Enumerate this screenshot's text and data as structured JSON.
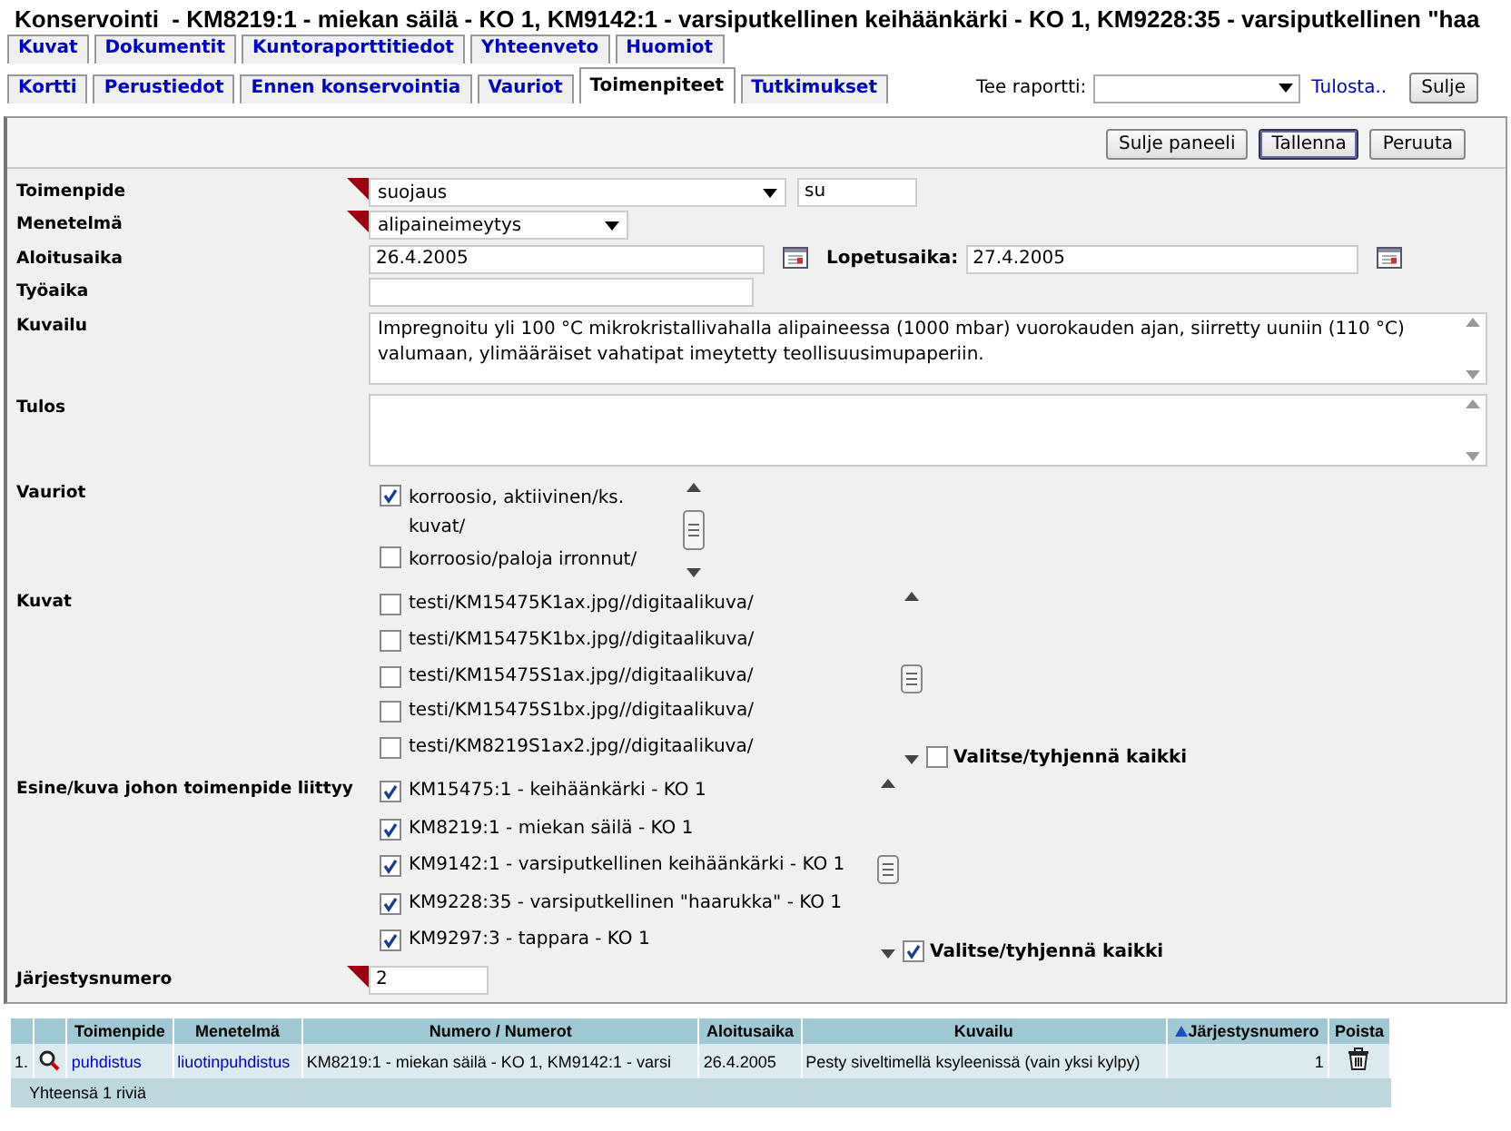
{
  "window": {
    "title": "Konservointi  - KM8219:1 - miekan säilä - KO 1, KM9142:1 - varsiputkellinen keihäänkärki - KO 1, KM9228:35 - varsiputkellinen \"haa"
  },
  "tabs_top": [
    {
      "label": "Kuvat",
      "selected": false
    },
    {
      "label": "Dokumentit",
      "selected": false
    },
    {
      "label": "Kuntoraporttitiedot",
      "selected": false
    },
    {
      "label": "Yhteenveto",
      "selected": false
    },
    {
      "label": "Huomiot",
      "selected": false
    }
  ],
  "tabs": [
    {
      "label": "Kortti",
      "selected": false
    },
    {
      "label": "Perustiedot",
      "selected": false
    },
    {
      "label": "Ennen konservointia",
      "selected": false
    },
    {
      "label": "Vauriot",
      "selected": false
    },
    {
      "label": "Toimenpiteet",
      "selected": true
    },
    {
      "label": "Tutkimukset",
      "selected": false
    }
  ],
  "report": {
    "label": "Tee raportti:",
    "print_link": "Tulosta..",
    "close_button": "Sulje"
  },
  "panel_buttons": [
    {
      "label": "Sulje paneeli",
      "focused": false
    },
    {
      "label": "Tallenna",
      "focused": true
    },
    {
      "label": "Peruuta",
      "focused": false
    }
  ],
  "fields": [
    {
      "kind": "select",
      "label": "Toimenpide",
      "required": true,
      "value": "suojaus",
      "code": "su"
    },
    {
      "kind": "select",
      "label": "Menetelmä",
      "required": true,
      "value": "alipaineimeytys"
    },
    {
      "kind": "date_pair",
      "label": "Aloitusaika",
      "value": "26.4.2005",
      "second_label": "Lopetusaika:",
      "second_value": "27.4.2005"
    },
    {
      "kind": "text",
      "label": "Työaika"
    },
    {
      "kind": "textarea",
      "label": "Kuvailu",
      "value": "Impregnoitu yli 100 °C mikrokristallivahalla alipaineessa (1000 mbar) vuorokauden ajan, siirretty uuniin (110 °C) valumaan, ylimääräiset vahatipat imeytetty teollisuusimupaperiin."
    },
    {
      "kind": "textarea",
      "label": "Tulos"
    },
    {
      "kind": "checklist",
      "label": "Vauriot",
      "items": [
        {
          "label": "korroosio, aktiivinen/ks. kuvat/",
          "checked": true
        },
        {
          "label": "korroosio/paloja irronnut/",
          "checked": false
        }
      ]
    },
    {
      "kind": "checklist",
      "label": "Kuvat",
      "items": [
        {
          "label": "testi/KM15475K1ax.jpg//digitaalikuva/",
          "checked": false
        },
        {
          "label": "testi/KM15475K1bx.jpg//digitaalikuva/",
          "checked": false
        },
        {
          "label": "testi/KM15475S1ax.jpg//digitaalikuva/",
          "checked": false
        },
        {
          "label": "testi/KM15475S1bx.jpg//digitaalikuva/",
          "checked": false
        },
        {
          "label": "testi/KM8219S1ax2.jpg//digitaalikuva/",
          "checked": false
        }
      ],
      "select_all": {
        "label": "Valitse/tyhjennä kaikki",
        "checked": false
      }
    },
    {
      "kind": "checklist",
      "label": "Esine/kuva johon toimenpide liittyy",
      "items": [
        {
          "label": "KM15475:1 - keihäänkärki - KO 1",
          "checked": true
        },
        {
          "label": "KM8219:1 - miekan säilä - KO 1",
          "checked": true
        },
        {
          "label": "KM9142:1 - varsiputkellinen keihäänkärki - KO 1",
          "checked": true
        },
        {
          "label": "KM9228:35 - varsiputkellinen \"haarukka\" - KO 1",
          "checked": true
        },
        {
          "label": "KM9297:3 - tappara - KO 1",
          "checked": true
        }
      ],
      "select_all": {
        "label": "Valitse/tyhjennä kaikki",
        "checked": true
      }
    },
    {
      "kind": "text",
      "label": "Järjestysnumero",
      "required": true,
      "value": "2"
    }
  ],
  "table": {
    "columns": [
      {
        "label": "Toimenpide",
        "sorted": false
      },
      {
        "label": "Menetelmä",
        "sorted": false
      },
      {
        "label": "Numero / Numerot",
        "sorted": false
      },
      {
        "label": "Aloitusaika",
        "sorted": false
      },
      {
        "label": "Kuvailu",
        "sorted": false
      },
      {
        "label": "Järjestysnumero",
        "sorted": true
      },
      {
        "label": "Poista",
        "sorted": false
      }
    ],
    "rows": [
      {
        "index": "1.",
        "toimenpide": "puhdistus",
        "menetelma": "liuotinpuhdistus",
        "numerot": "KM8219:1 - miekan säilä - KO 1, KM9142:1 - varsi",
        "aloitusaika": "26.4.2005",
        "kuvailu": "Pesty siveltimellä ksyleenissä (vain yksi kylpy)",
        "jarjestysnumero": "1"
      }
    ],
    "footer": "Yhteensä 1 riviä"
  }
}
